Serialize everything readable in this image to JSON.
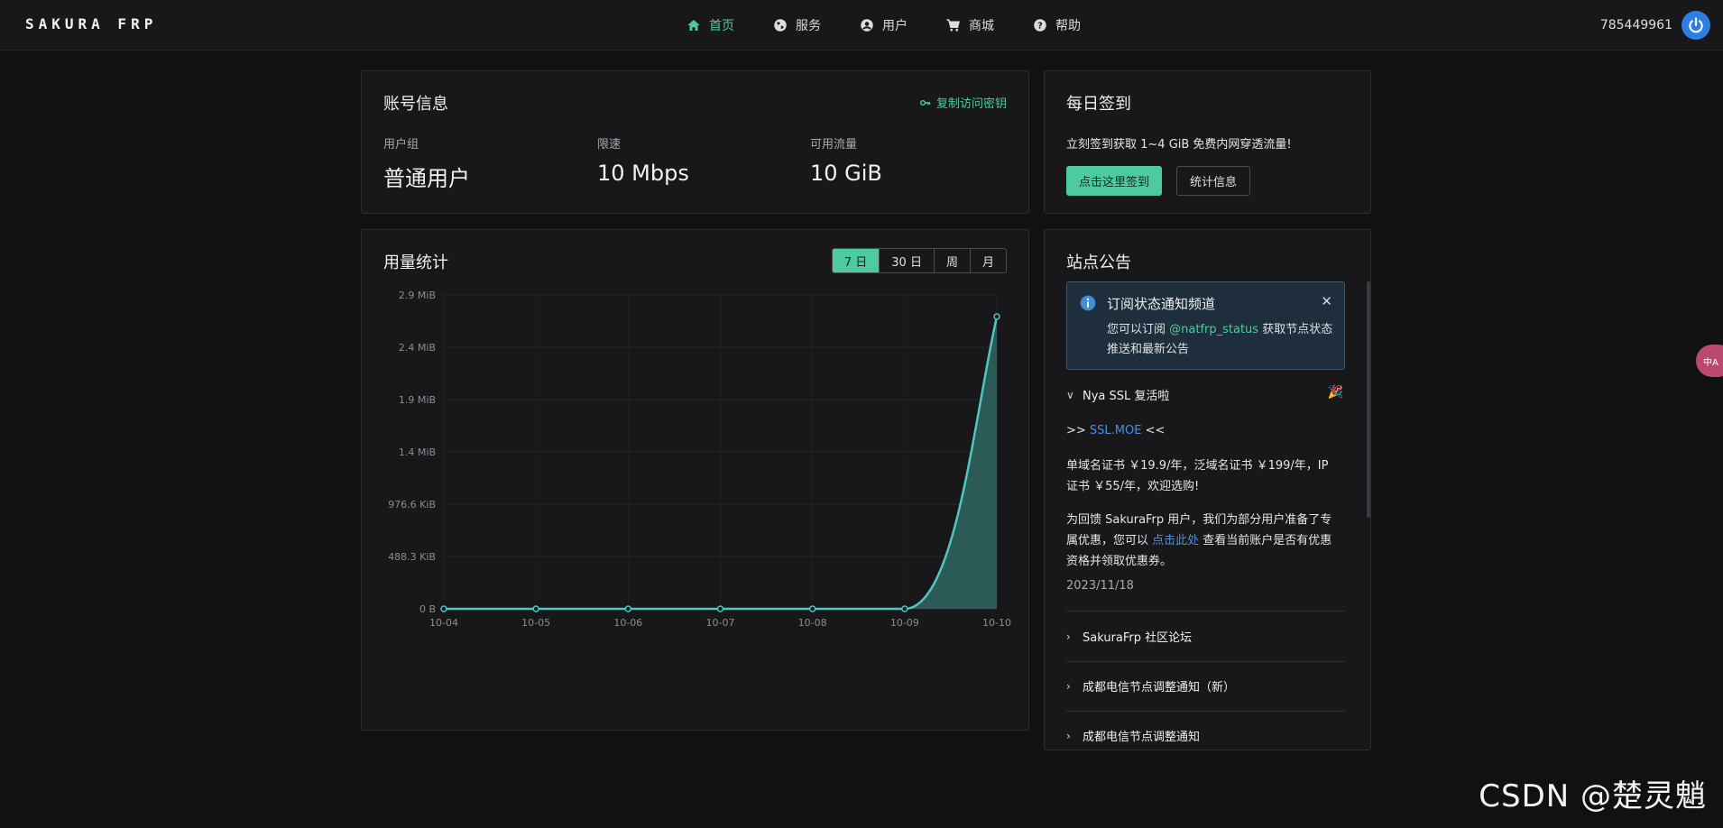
{
  "nav": {
    "brand": "SAKURA FRP",
    "items": [
      {
        "label": "首页",
        "icon": "home-icon",
        "active": true
      },
      {
        "label": "服务",
        "icon": "globe-icon",
        "active": false
      },
      {
        "label": "用户",
        "icon": "user-icon",
        "active": false
      },
      {
        "label": "商城",
        "icon": "cart-icon",
        "active": false
      },
      {
        "label": "帮助",
        "icon": "help-icon",
        "active": false
      }
    ],
    "user_id": "785449961"
  },
  "account": {
    "title": "账号信息",
    "copy_key_label": "复制访问密钥",
    "stats": [
      {
        "label": "用户组",
        "value": "普通用户"
      },
      {
        "label": "限速",
        "value": "10 Mbps"
      },
      {
        "label": "可用流量",
        "value": "10 GiB"
      }
    ]
  },
  "signin": {
    "title": "每日签到",
    "desc": "立刻签到获取 1~4 GiB 免费内网穿透流量!",
    "primary_label": "点击这里签到",
    "secondary_label": "统计信息"
  },
  "usage": {
    "title": "用量统计",
    "ranges": [
      {
        "label": "7 日",
        "active": true
      },
      {
        "label": "30 日",
        "active": false
      },
      {
        "label": "周",
        "active": false
      },
      {
        "label": "月",
        "active": false
      }
    ]
  },
  "chart_data": {
    "type": "area",
    "categories": [
      "10-04",
      "10-05",
      "10-06",
      "10-07",
      "10-08",
      "10-09",
      "10-10"
    ],
    "values": [
      0,
      0,
      0,
      0,
      0,
      0,
      2.7
    ],
    "y_ticks": [
      "0 B",
      "488.3 KiB",
      "976.6 KiB",
      "1.4 MiB",
      "1.9 MiB",
      "2.4 MiB",
      "2.9 MiB"
    ],
    "ylim": [
      0,
      2.9
    ],
    "y_unit_scale": "MiB",
    "grid": true,
    "color": "#4fc6c0",
    "fill": "#2d5f5b"
  },
  "notice": {
    "title": "站点公告",
    "alert": {
      "title": "订阅状态通知频道",
      "body_prefix": "您可以订阅 ",
      "body_link": "@natfrp_status",
      "body_suffix": " 获取节点状态推送和最新公告",
      "close": "✕"
    },
    "open_item": {
      "title": "Nya SSL 复活啦",
      "emoji": "🎉",
      "line1_prefix": ">> ",
      "line1_link": "SSL.MOE",
      "line1_suffix": " <<",
      "para1": "单域名证书 ￥19.9/年，泛域名证书 ￥199/年，IP 证书 ￥55/年，欢迎选购!",
      "para2_prefix": "为回馈 SakuraFrp 用户，我们为部分用户准备了专属优惠，您可以 ",
      "para2_link": "点击此处",
      "para2_suffix": " 查看当前账户是否有优惠资格并领取优惠券。",
      "date": "2023/11/18"
    },
    "collapsed_items": [
      "SakuraFrp 社区论坛",
      "成都电信节点调整通知（新）",
      "成都电信节点调整通知"
    ]
  },
  "watermark": "CSDN @楚灵魈",
  "side_float": "中A"
}
